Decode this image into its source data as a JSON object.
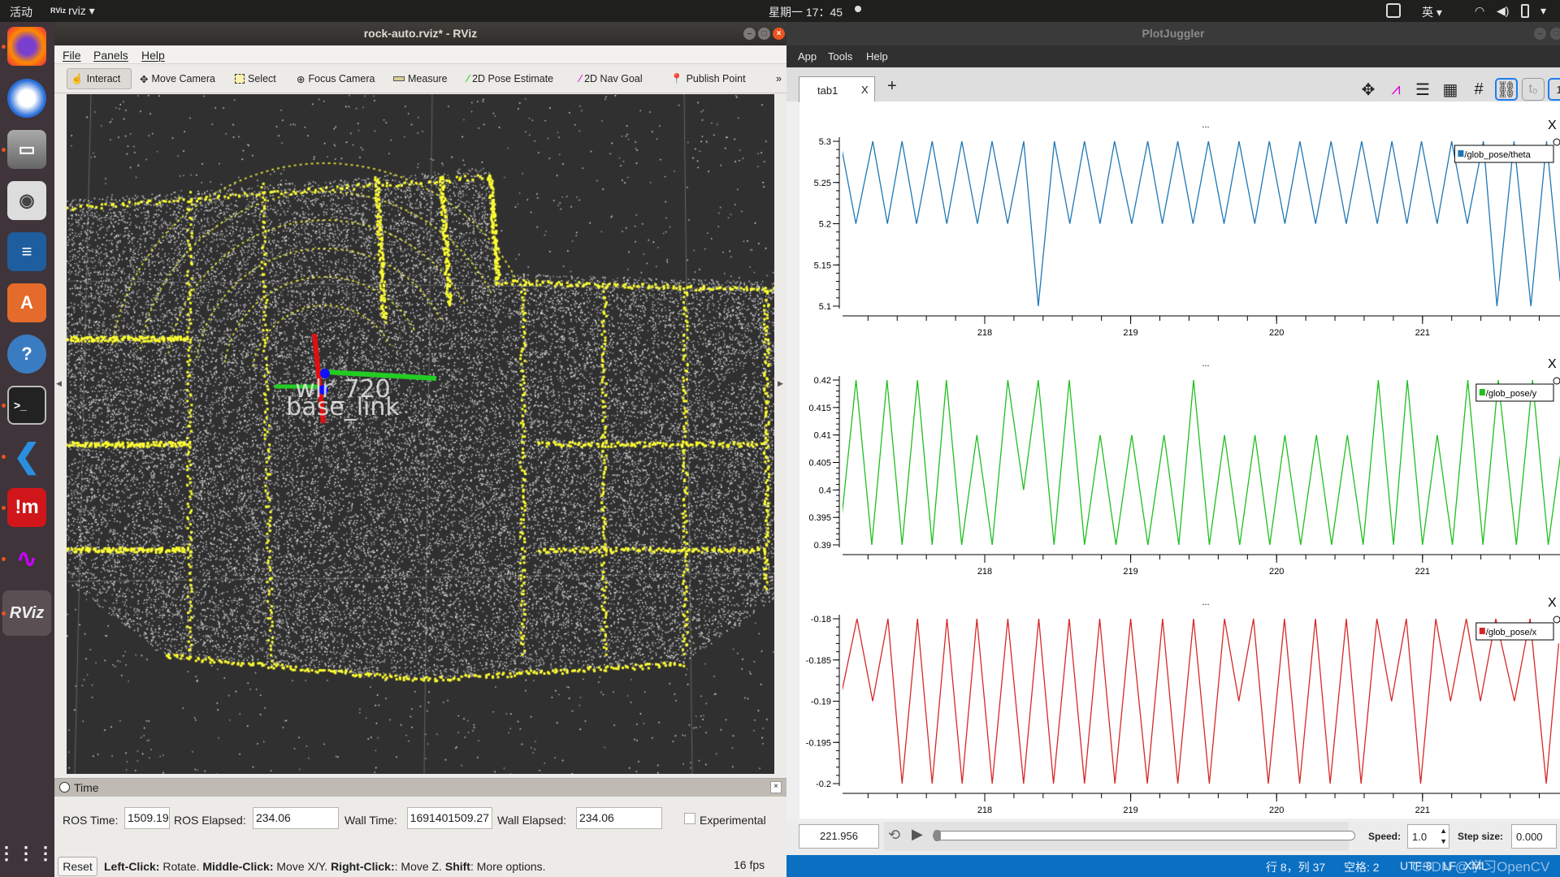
{
  "topbar": {
    "activities": "活动",
    "app": "rviz ▾",
    "clock": "星期一 17：45",
    "input_method": "英 ▾"
  },
  "launcher": {
    "items": [
      "firefox",
      "thunderbird",
      "files",
      "rhythmbox",
      "libreoffice-writer",
      "software-center",
      "help",
      "terminal",
      "vscode",
      "im",
      "plotjuggler",
      "rviz"
    ]
  },
  "rviz": {
    "title": "rock-auto.rviz* - RViz",
    "menu": [
      "File",
      "Panels",
      "Help"
    ],
    "toolbar": [
      "Interact",
      "Move Camera",
      "Select",
      "Focus Camera",
      "Measure",
      "2D Pose Estimate",
      "2D Nav Goal",
      "Publish Point"
    ],
    "toolbar_more": "»",
    "scene_labels": {
      "frame1": "wlr_720",
      "frame2": "base_link"
    },
    "time_panel": {
      "title": "Time",
      "ros_time_label": "ROS Time:",
      "ros_time": "1509.19",
      "ros_elapsed_label": "ROS Elapsed:",
      "ros_elapsed": "234.06",
      "wall_time_label": "Wall Time:",
      "wall_time": "1691401509.27",
      "wall_elapsed_label": "Wall Elapsed:",
      "wall_elapsed": "234.06",
      "experimental": "Experimental",
      "experimental_checked": false
    },
    "reset": "Reset",
    "hint": [
      {
        "b": "Left-Click:",
        "t": " Rotate. "
      },
      {
        "b": "Middle-Click:",
        "t": " Move X/Y. "
      },
      {
        "b": "Right-Click:",
        "t": ": Move Z. "
      },
      {
        "b": "Shift",
        "t": ": More options."
      }
    ],
    "fps": "16 fps"
  },
  "plotjuggler": {
    "title": "PlotJuggler",
    "menu": [
      "App",
      "Tools",
      "Help"
    ],
    "tabs": [
      {
        "label": "tab1",
        "close": "X"
      }
    ],
    "add_tab": "+",
    "plot_title": "...",
    "close": "X",
    "time_value": "221.956",
    "speed_label": "Speed:",
    "speed": "1.0",
    "step_label": "Step size:",
    "step": "0.000",
    "slider_fraction": 0.0
  },
  "statusbar": {
    "position": "行 8，列 37",
    "spaces": "空格: 2",
    "encoding": "UTF-8",
    "eol": "LF",
    "lang": "XML",
    "watermark": "CSDN @学习OpenCV"
  },
  "chart_data": [
    {
      "type": "line",
      "xlim": [
        217.0,
        221.95
      ],
      "ylim": [
        5.1,
        5.3
      ],
      "xticks": [
        218,
        219,
        220,
        221
      ],
      "yticks": [
        5.1,
        5.15,
        5.2,
        5.25,
        5.3
      ],
      "legend": "top-right",
      "series": [
        {
          "name": "/glob_pose/theta",
          "color": "#1f77b4",
          "x": [
            217.01,
            217.117,
            217.233,
            217.333,
            217.433,
            217.533,
            217.64,
            217.74,
            217.843,
            217.95,
            218.05,
            218.157,
            218.267,
            218.367,
            218.477,
            218.583,
            218.683,
            218.79,
            218.89,
            219.007,
            219.117,
            219.217,
            219.323,
            219.427,
            219.533,
            219.64,
            219.743,
            219.85,
            219.95,
            220.057,
            220.16,
            220.267,
            220.373,
            220.477,
            220.583,
            220.69,
            220.79,
            220.893,
            220.993,
            221.1,
            221.2,
            221.307,
            221.417,
            221.51,
            221.627,
            221.743,
            221.85,
            221.943
          ],
          "y": [
            5.3,
            5.2,
            5.3,
            5.2,
            5.3,
            5.2,
            5.3,
            5.2,
            5.3,
            5.2,
            5.3,
            5.2,
            5.3,
            5.1,
            5.3,
            5.2,
            5.3,
            5.2,
            5.3,
            5.2,
            5.3,
            5.2,
            5.3,
            5.2,
            5.3,
            5.2,
            5.3,
            5.2,
            5.3,
            5.2,
            5.3,
            5.2,
            5.3,
            5.2,
            5.3,
            5.2,
            5.3,
            5.2,
            5.3,
            5.2,
            5.3,
            5.2,
            5.3,
            5.1,
            5.3,
            5.1,
            5.3,
            5.13
          ]
        }
      ]
    },
    {
      "type": "line",
      "xlim": [
        217.0,
        221.95
      ],
      "ylim": [
        0.39,
        0.42
      ],
      "xticks": [
        218,
        219,
        220,
        221
      ],
      "yticks": [
        0.39,
        0.395,
        0.4,
        0.405,
        0.41,
        0.415,
        0.42
      ],
      "legend": "top-right",
      "series": [
        {
          "name": "/glob_pose/y",
          "color": "#1ec01e",
          "x": [
            217.0,
            217.118,
            217.226,
            217.33,
            217.434,
            217.539,
            217.64,
            217.737,
            217.842,
            217.946,
            218.051,
            218.158,
            218.266,
            218.367,
            218.475,
            218.579,
            218.684,
            218.791,
            218.899,
            219.007,
            219.118,
            219.229,
            219.33,
            219.431,
            219.539,
            219.643,
            219.747,
            219.852,
            219.953,
            220.057,
            220.165,
            220.273,
            220.377,
            220.485,
            220.593,
            220.697,
            220.801,
            220.896,
            221.0,
            221.101,
            221.205,
            221.31,
            221.414,
            221.519,
            221.643,
            221.754,
            221.862,
            221.949
          ],
          "y": [
            0.39,
            0.42,
            0.39,
            0.42,
            0.39,
            0.42,
            0.39,
            0.42,
            0.39,
            0.41,
            0.39,
            0.42,
            0.4,
            0.42,
            0.39,
            0.42,
            0.39,
            0.41,
            0.39,
            0.41,
            0.39,
            0.41,
            0.39,
            0.42,
            0.39,
            0.41,
            0.39,
            0.41,
            0.39,
            0.41,
            0.39,
            0.41,
            0.39,
            0.41,
            0.39,
            0.42,
            0.39,
            0.42,
            0.39,
            0.41,
            0.39,
            0.42,
            0.39,
            0.42,
            0.39,
            0.42,
            0.39,
            0.407
          ]
        }
      ]
    },
    {
      "type": "line",
      "xlim": [
        217.0,
        221.95
      ],
      "ylim": [
        -0.2,
        -0.18
      ],
      "xticks": [
        218,
        219,
        220,
        221
      ],
      "yticks": [
        -0.2,
        -0.195,
        -0.19,
        -0.185,
        -0.18
      ],
      "legend": "top-right",
      "series": [
        {
          "name": "/glob_pose/x",
          "color": "#d62728",
          "x": [
            217.007,
            217.125,
            217.232,
            217.337,
            217.434,
            217.539,
            217.64,
            217.741,
            217.845,
            217.946,
            218.051,
            218.158,
            218.266,
            218.37,
            218.471,
            218.579,
            218.684,
            218.788,
            218.892,
            219.0,
            219.114,
            219.219,
            219.323,
            219.431,
            219.539,
            219.643,
            219.741,
            219.842,
            219.943,
            220.054,
            220.158,
            220.266,
            220.367,
            220.478,
            220.579,
            220.687,
            220.788,
            220.889,
            220.987,
            221.091,
            221.192,
            221.3,
            221.397,
            221.502,
            221.63,
            221.737,
            221.848,
            221.933
          ],
          "y": [
            -0.19,
            -0.18,
            -0.19,
            -0.18,
            -0.2,
            -0.18,
            -0.2,
            -0.18,
            -0.2,
            -0.18,
            -0.2,
            -0.18,
            -0.2,
            -0.18,
            -0.2,
            -0.18,
            -0.2,
            -0.18,
            -0.2,
            -0.18,
            -0.2,
            -0.18,
            -0.2,
            -0.18,
            -0.2,
            -0.18,
            -0.19,
            -0.18,
            -0.2,
            -0.18,
            -0.2,
            -0.18,
            -0.2,
            -0.18,
            -0.2,
            -0.18,
            -0.19,
            -0.18,
            -0.2,
            -0.18,
            -0.19,
            -0.18,
            -0.19,
            -0.18,
            -0.19,
            -0.18,
            -0.2,
            -0.183
          ]
        }
      ]
    }
  ]
}
